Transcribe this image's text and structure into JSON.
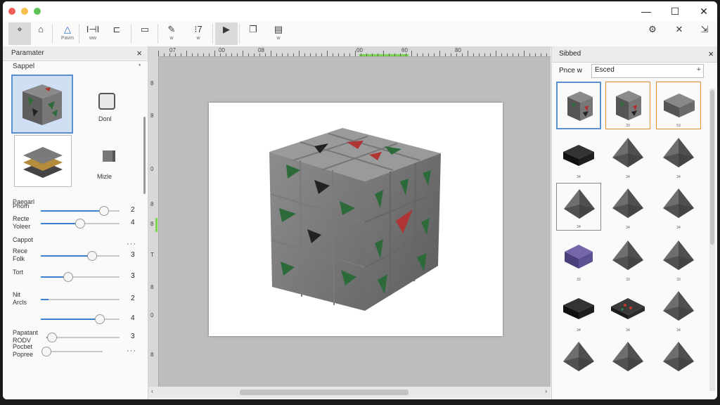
{
  "toolbar": {
    "buttons": [
      {
        "name": "select-tool",
        "icon": "cursor-icon",
        "glyph": "⌖",
        "label": ""
      },
      {
        "name": "home-tool",
        "icon": "home-icon",
        "glyph": "⌂",
        "label": ""
      },
      {
        "name": "prism-tool",
        "icon": "triangle-icon",
        "glyph": "△",
        "label": "Pavm"
      },
      {
        "name": "tool-4",
        "icon": "dimension-icon",
        "glyph": "I⊣I",
        "label": "ww"
      },
      {
        "name": "tool-5",
        "icon": "bracket-icon",
        "glyph": "⊏",
        "label": ""
      },
      {
        "name": "tool-6",
        "icon": "monitor-icon",
        "glyph": "▭",
        "label": ""
      },
      {
        "name": "tool-7",
        "icon": "paint-icon",
        "glyph": "✎",
        "label": "w"
      },
      {
        "name": "tool-8",
        "icon": "measure-icon",
        "glyph": "⁝7",
        "label": "w"
      },
      {
        "name": "play-tool",
        "icon": "play-icon",
        "glyph": "▶",
        "label": ""
      },
      {
        "name": "tool-10",
        "icon": "layers-icon",
        "glyph": "❐",
        "label": ""
      },
      {
        "name": "tool-11",
        "icon": "stack-icon",
        "glyph": "▤",
        "label": "w"
      }
    ],
    "right_buttons": [
      {
        "name": "settings-button",
        "icon": "gear-icon",
        "glyph": "⚙"
      },
      {
        "name": "close-tool-button",
        "icon": "close-icon",
        "glyph": "✕"
      },
      {
        "name": "export-button",
        "icon": "export-icon",
        "glyph": "⇲"
      }
    ]
  },
  "left_panel": {
    "title": "Paramater",
    "close_glyph": "×",
    "subtitle": "Sappel",
    "sub_collapse": "*",
    "thumbs": [
      {
        "label": "Donl"
      },
      {
        "label": "Mizle"
      }
    ],
    "header_small": "Paegarl",
    "params": [
      {
        "label": "Phom",
        "value": "2",
        "level": 0.8
      },
      {
        "label": "Recte\nYoleer",
        "value": "4",
        "level": 0.5
      },
      {
        "label": "Cappot",
        "value": "···",
        "level": null
      },
      {
        "label": "Rece\nFolk",
        "value": "3",
        "level": 0.65
      },
      {
        "label": "Tort",
        "value": "3",
        "level": 0.35
      },
      {
        "label": "Nit\nArcls",
        "value": "2",
        "level": 0.1
      },
      {
        "label": "",
        "value": "4",
        "level": 0.75
      },
      {
        "label": "Papatant\nRODV",
        "value": "3",
        "level": 0.08
      },
      {
        "label": "Pocbet\nPopree",
        "value": "···",
        "level": 0.0
      }
    ]
  },
  "canvas": {
    "ruler_h_ticks": [
      "07",
      "00",
      "08",
      "00",
      "60",
      "80"
    ],
    "ruler_v_ticks": [
      "8",
      "8",
      "0",
      "8",
      "8",
      "T",
      "8",
      "0",
      "8"
    ]
  },
  "right_panel": {
    "title": "Sibbed",
    "close_glyph": "×",
    "preview_label": "Pnce w",
    "search_value": "Esced",
    "search_add": "+",
    "items": [
      {
        "shape": "cube-pattern",
        "cap": "",
        "state": "sel"
      },
      {
        "shape": "cube-pattern",
        "cap": "33",
        "state": "hl"
      },
      {
        "shape": "slab-gray",
        "cap": "53",
        "state": "hl"
      },
      {
        "shape": "slab-black",
        "cap": "34",
        "state": ""
      },
      {
        "shape": "pyramid",
        "cap": "34",
        "state": ""
      },
      {
        "shape": "pyramid",
        "cap": "34",
        "state": ""
      },
      {
        "shape": "pyramid",
        "cap": "24",
        "state": "gr"
      },
      {
        "shape": "pyramid",
        "cap": "34",
        "state": ""
      },
      {
        "shape": "pyramid",
        "cap": "34",
        "state": ""
      },
      {
        "shape": "slab-purple",
        "cap": "33",
        "state": ""
      },
      {
        "shape": "pyramid",
        "cap": "33",
        "state": ""
      },
      {
        "shape": "pyramid",
        "cap": "33",
        "state": ""
      },
      {
        "shape": "slab-black",
        "cap": "34",
        "state": ""
      },
      {
        "shape": "slab-red",
        "cap": "34",
        "state": ""
      },
      {
        "shape": "pyramid",
        "cap": "34",
        "state": ""
      },
      {
        "shape": "pyramid",
        "cap": "",
        "state": ""
      },
      {
        "shape": "pyramid",
        "cap": "",
        "state": ""
      },
      {
        "shape": "pyramid",
        "cap": "",
        "state": ""
      }
    ]
  }
}
